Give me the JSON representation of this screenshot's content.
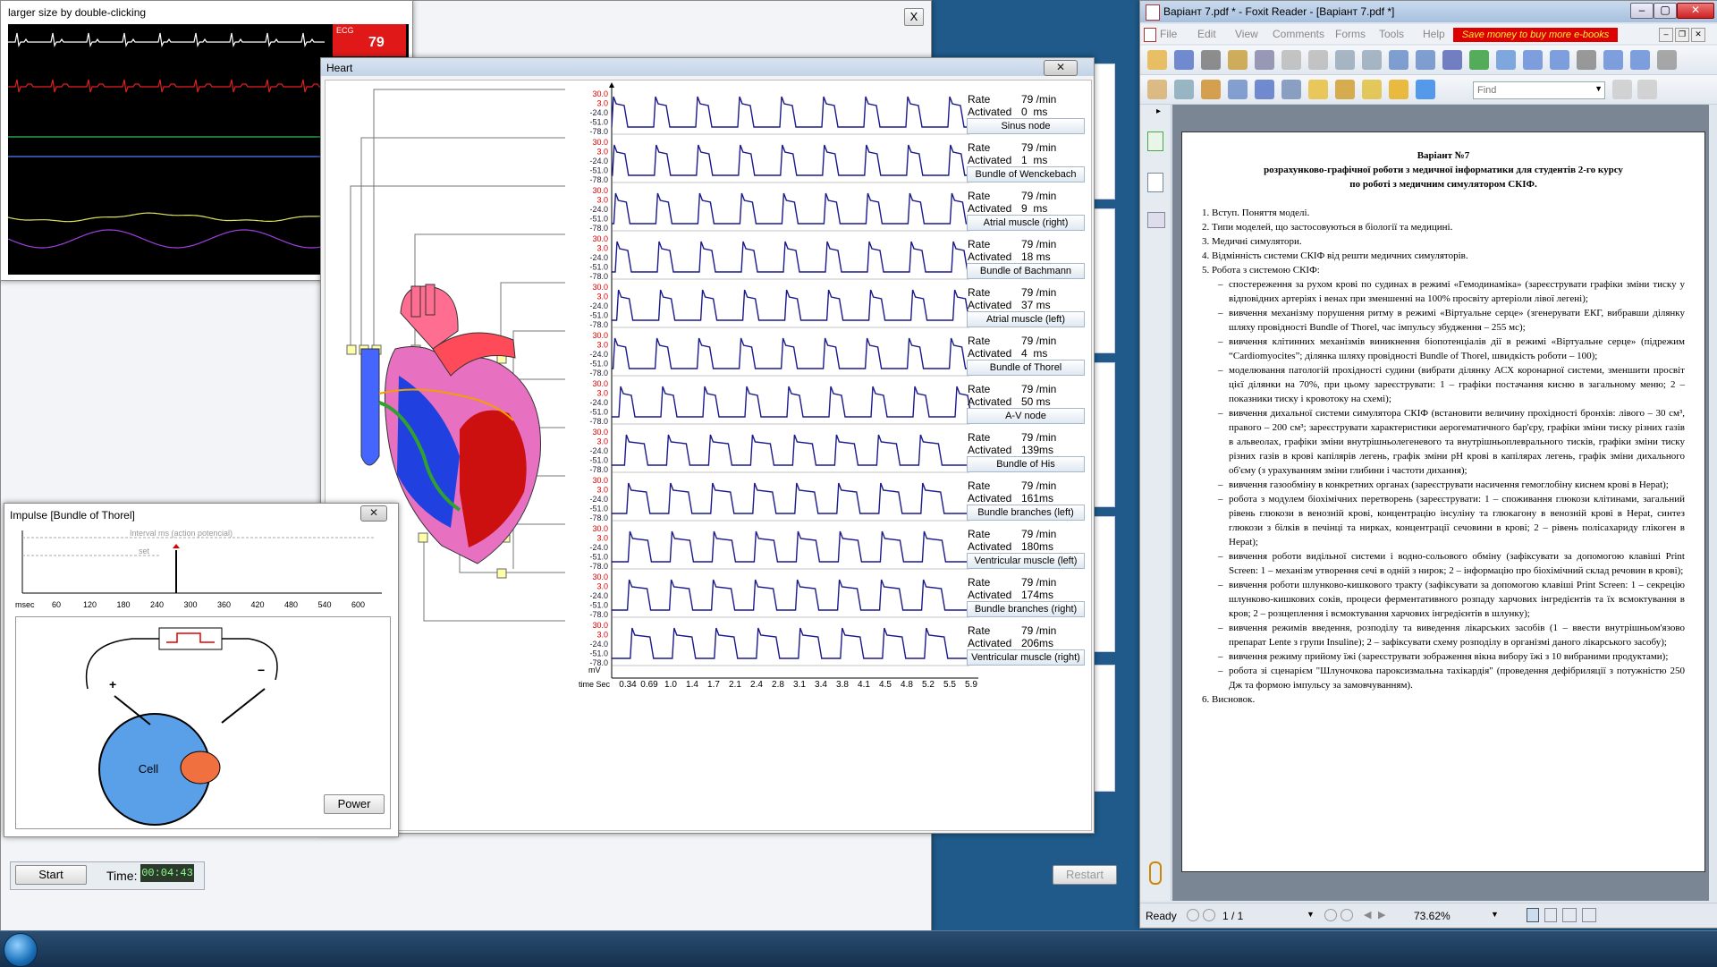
{
  "ecg_window": {
    "title": "larger size by double-clicking",
    "badge_label": "ECG",
    "badge_value": "79"
  },
  "heart_window": {
    "title": "Heart",
    "left_ticks": [
      "30.0",
      "3.0",
      "-24.0",
      "-51.0",
      "-78.0"
    ],
    "rows": [
      {
        "rate": "79 /min",
        "activated": "0  ms",
        "name": "Sinus node"
      },
      {
        "rate": "79 /min",
        "activated": "1  ms",
        "name": "Bundle of Wenckebach"
      },
      {
        "rate": "79 /min",
        "activated": "9  ms",
        "name": "Atrial muscle (right)"
      },
      {
        "rate": "79 /min",
        "activated": "18 ms",
        "name": "Bundle of Bachmann"
      },
      {
        "rate": "79 /min",
        "activated": "37 ms",
        "name": "Atrial muscle (left)"
      },
      {
        "rate": "79 /min",
        "activated": "4  ms",
        "name": "Bundle of Thorel"
      },
      {
        "rate": "79 /min",
        "activated": "50 ms",
        "name": "A-V node"
      },
      {
        "rate": "79 /min",
        "activated": "139ms",
        "name": "Bundle of His"
      },
      {
        "rate": "79 /min",
        "activated": "161ms",
        "name": "Bundle branches (left)"
      },
      {
        "rate": "79 /min",
        "activated": "180ms",
        "name": "Ventricular muscle (left)"
      },
      {
        "rate": "79 /min",
        "activated": "174ms",
        "name": "Bundle branches (right)"
      },
      {
        "rate": "79 /min",
        "activated": "206ms",
        "name": "Ventricular muscle (right)"
      }
    ],
    "rate_label": "Rate",
    "activated_label": "Activated",
    "time_label": "time Sec",
    "mv_label": "mV",
    "time_ticks": [
      "0.34",
      "0.69",
      "1.0",
      "1.4",
      "1.7",
      "2.1",
      "2.4",
      "2.8",
      "3.1",
      "3.4",
      "3.8",
      "4.1",
      "4.5",
      "4.8",
      "5.2",
      "5.5",
      "5.9"
    ]
  },
  "impulse_window": {
    "title": "Impulse [Bundle of Thorel]",
    "interval_label": "Interval ms (action potencial)",
    "set_label": "set",
    "axis_unit": "msec",
    "axis_ticks": [
      "60",
      "120",
      "180",
      "240",
      "300",
      "360",
      "420",
      "480",
      "540",
      "600"
    ],
    "cell_label": "Cell",
    "power_button": "Power",
    "plus": "+",
    "minus": "−"
  },
  "sim_window": {
    "start_button": "Start",
    "time_label": "Time:",
    "time_value": "00:04:43",
    "restart_button": "Restart",
    "close_icon": "X"
  },
  "foxit": {
    "title": "Варіант 7.pdf * - Foxit Reader - [Варіант 7.pdf *]",
    "menu": [
      "File",
      "Edit",
      "View",
      "Comments",
      "Forms",
      "Tools",
      "Help"
    ],
    "promo": "Save money to buy more e-books",
    "find_placeholder": "Find",
    "status_ready": "Ready",
    "page_value": "1 / 1",
    "zoom_value": "73.62%",
    "doc_title1": "Варіант №7",
    "doc_title2": "розрахунково-графічної роботи з медичної інформатики для студентів 2-го курсу",
    "doc_title3": "по роботі з медичним симулятором СКІФ.",
    "items": [
      "1. Вступ. Поняття моделі.",
      "2. Типи моделей, що застосовуються в біології та медицині.",
      "3. Медичні симулятори.",
      "4. Відмінність системи СКІФ від решти медичних симуляторів.",
      "5. Робота з системою СКІФ:"
    ],
    "bullets": [
      "спостереження за рухом крові по судинах в режимі «Гемодинаміка» (зареєструвати графіки зміни тиску у відповідних артеріях і венах при зменшенні на 100% просвіту артеріоли лівої легені);",
      "вивчення механізму порушення ритму в режимі «Віртуальне серце» (згенерувати ЕКГ, вибравши ділянку шляху провідності Bundle of Thorel, час імпульсу збудження – 255 мс);",
      "вивчення клітинних механізмів виникнення біопотенціалів дії в режимі «Віртуальне серце» (підрежим “Cardiomyocites”; ділянка шляху провідності Bundle of Thorel, швидкість роботи – 100);",
      "моделювання патологій прохідності судини (вибрати ділянку АСХ коронарної системи, зменшити просвіт цієї ділянки на 70%, при цьому зареєструвати: 1 – графіки постачання кисню в загальному меню; 2 – показники тиску і кровотоку на схемі);",
      "вивчення дихальної системи симулятора СКІФ (встановити величину прохідності бронхів: лівого – 30 см³, правого – 200 см³; зареєструвати характеристики аерогематичного бар'єру, графіки зміни тиску різних газів в альвеолах, графіки зміни внутрішньолегеневого та внутрішньоплеврального тисків, графіки зміни тиску різних газів в крові капілярів легень, графік зміни pH крові в капілярах легень, графік зміни дихального об'єму (з урахуванням зміни глибини і частоти дихання);",
      "вивчення газообміну в конкретних органах (зареєструвати насичення гемоглобіну киснем крові в Нерat);",
      "робота з модулем біохімічних перетворень (зареєструвати: 1 – споживання глюкози клітинами, загальний рівень глюкози в венозній крові, концентрацію інсуліну та глюкагону в венозній крові в Нерat, синтез глюкози з білків в печінці та нирках, концентрації сечовини в крові; 2 – рівень полісахариду глікоген в Нерat);",
      "вивчення роботи видільної системи і водно-сольового обміну (зафіксувати за допомогою клавіші Print Screen: 1 – механізм утворення сечі в одній з нирок; 2 – інформацію про біохімічний склад речовин в крові);",
      "вивчення роботи шлунково-кишкового тракту (зафіксувати за допомогою клавіші Print Screen: 1 – секрецію шлунково-кишкових соків, процеси ферментативного розпаду харчових інгредієнтів та їх всмоктування в кров; 2 – розщеплення і всмоктування харчових інгредієнтів в шлунку);",
      "вивчення режимів введення, розподілу та виведення лікарських засобів (1 – ввести внутрішньом'язово препарат Lente з групи Insuline); 2 – зафіксувати схему розподілу в організмі даного лікарського засобу);",
      "вивчення режиму прийому їжі (зареєструвати зображення вікна вибору їжі з 10 вибраними продуктами);",
      "робота зі сценарієм \"Шлуночкова пароксизмальна тахікардія\" (проведення дефібриляції з потужністю 250 Дж та формою імпульсу за замовчуванням)."
    ],
    "item6": "6. Висновок."
  },
  "colors": {
    "desktop": "#1f5a8a",
    "trace_blue": "#1a1a8c",
    "ecg_red": "#e02020",
    "ecg_green": "#30c060",
    "ecg_blue": "#5080ff",
    "ecg_yellow": "#e0e060",
    "ecg_purple": "#a040e0",
    "badge": "#e01818"
  }
}
